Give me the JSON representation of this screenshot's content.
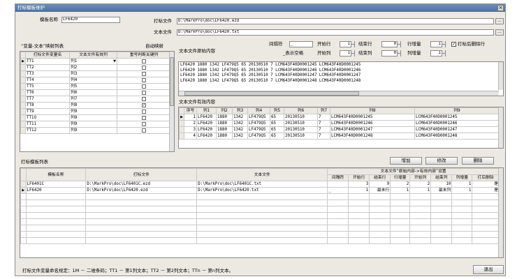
{
  "window": {
    "title": "打标模板维护",
    "close": "×"
  },
  "template_name": {
    "label": "模板名称",
    "value": "LF6420"
  },
  "print_file": {
    "label": "打标文件",
    "value": "D:\\MarkPro\\doc\\LF6420.ezd",
    "browse": "..."
  },
  "text_file": {
    "label": "文本文件",
    "value": "D:\\MarkPro\\doc\\LF6420.txt",
    "browse": "..."
  },
  "mapping": {
    "title": "“变量-文本”映射列表",
    "auto_button": "自动映射",
    "headers": [
      "打标文件变量名",
      "文本文件有效列",
      "重号判断关键列"
    ],
    "rows": [
      {
        "var": "TT1",
        "col": "列1",
        "key": false
      },
      {
        "var": "TT2",
        "col": "列2",
        "key": false
      },
      {
        "var": "TT3",
        "col": "列3",
        "key": false
      },
      {
        "var": "TT4",
        "col": "列4",
        "key": false
      },
      {
        "var": "TT5",
        "col": "列5",
        "key": false
      },
      {
        "var": "TT6",
        "col": "列6",
        "key": false
      },
      {
        "var": "TT7",
        "col": "列7",
        "key": false
      },
      {
        "var": "TT8",
        "col": "列8",
        "key": true
      },
      {
        "var": "TT9",
        "col": "列9",
        "key": false
      },
      {
        "var": "TT10",
        "col": "列9",
        "key": false
      },
      {
        "var": "TT11",
        "col": "列9",
        "key": false
      },
      {
        "var": "TT12",
        "col": "列9",
        "key": false
      }
    ]
  },
  "settings": {
    "separator_label": "间隔符",
    "separator_value": "_",
    "space_hint": "_表示空格",
    "start_row_label": "开始行",
    "start_row": "1",
    "end_row_label": "结束行",
    "end_row": "0",
    "row_inc_label": "行增量",
    "row_inc": "1",
    "start_col_label": "开始列",
    "start_col": "1",
    "end_col_label": "结束列",
    "end_col": "0",
    "col_inc_label": "列增量",
    "col_inc": "1",
    "delete_after_label": "打标后删除行",
    "delete_after": true
  },
  "raw_content": {
    "title": "文本文件原始内容",
    "lines": [
      "LF6420 1880 1342 LF479Q5 65 20130510 7 LCM643F40D0001245 LCM643F40D0001245",
      "LF6420 1880 1342 LF479Q5 65 20130510 7 LCM643F40D0001246 LCM643F40D0001246",
      "LF6420 1880 1342 LF479Q5 65 20130510 7 LCM643F40D0001247 LCM643F40D0001247",
      "LF6420 1880 1342 LF479Q5 65 20130510 7 LCM643F40D0001248 LCM643F40D0001248"
    ]
  },
  "valid_content": {
    "title": "文本文件有效内容",
    "headers": [
      "序号",
      "列1",
      "列2",
      "列3",
      "列4",
      "列5",
      "列6",
      "列7",
      "列8",
      "列9"
    ],
    "rows": [
      [
        "1",
        "LF6420",
        "1880",
        "1342",
        "LF479Q5",
        "65",
        "20130510",
        "7",
        "LCM643F40D0001245",
        "LCM643F40D0001245"
      ],
      [
        "2",
        "LF6420",
        "1880",
        "1342",
        "LF479Q5",
        "65",
        "20130510",
        "7",
        "LCM643F40D0001246",
        "LCM643F40D0001246"
      ],
      [
        "3",
        "LF6420",
        "1880",
        "1342",
        "LF479Q5",
        "65",
        "20130510",
        "7",
        "LCM643F40D0001247",
        "LCM643F40D0001247"
      ],
      [
        "4",
        "LF6420",
        "1880",
        "1342",
        "LF479Q5",
        "65",
        "20130510",
        "7",
        "LCM643F40D0001248",
        "LCM643F40D0001248"
      ]
    ]
  },
  "template_list": {
    "title": "打标模板列表",
    "add": "增加",
    "edit": "修改",
    "delete": "删除",
    "headers": [
      "模板名称",
      "打标文件",
      "文本文件"
    ],
    "group_header": "文本文件“原始内容->有效内容”设置",
    "sub_headers": [
      "间隔符",
      "开始行",
      "结束行",
      "行增量",
      "开始列",
      "结束列",
      "列增量",
      "打后删除"
    ],
    "rows": [
      {
        "name": "LF6401C",
        "print": "D:\\MarkPro\\doc\\LF6401C.ezd",
        "text": "D:\\MarkPro\\doc\\LF6401C.txt",
        "sep": "",
        "sr": "3",
        "er": "9",
        "ri": "2",
        "sc": "2",
        "ec": "10",
        "ci": "1",
        "del": "是"
      },
      {
        "name": "LF6420",
        "print": "D:\\MarkPro\\doc\\LF6420.ezd",
        "text": "D:\\MarkPro\\doc\\LF6420.txt",
        "sep": "_",
        "sr": "1",
        "er": "最末行",
        "ri": "1",
        "sc": "1",
        "ec": "最末列",
        "ci": "1",
        "del": "是"
      }
    ]
  },
  "footer": {
    "rule": "打标文件变量命名规定：1M － 二维条码；TT1 － 第1列文本；TT2 － 第2列文本；TTn － 第n列文本。",
    "exit": "退出"
  }
}
